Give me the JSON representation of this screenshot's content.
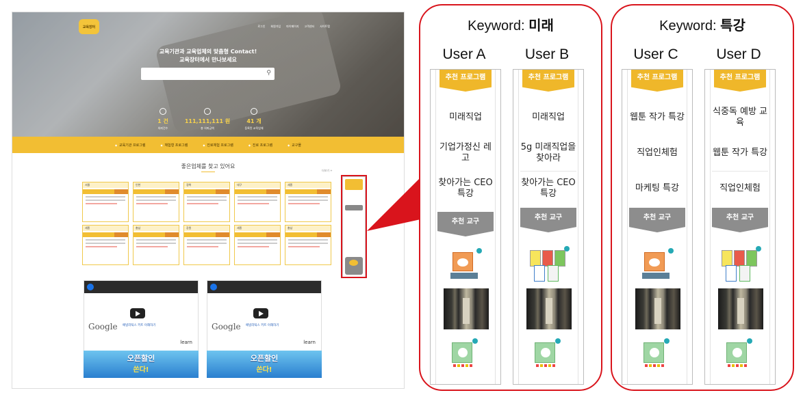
{
  "site": {
    "logo_text": "교육장터",
    "topnav": [
      "로그인",
      "회원가입",
      "마이페이지",
      "고객센터",
      "사이트맵"
    ],
    "hero_line1": "교육기관과 교육업체의 맞춤형 Contact!",
    "hero_line2": "교육장터에서 만나보세요",
    "search_placeholder": "",
    "stats": [
      {
        "value": "1 건",
        "label": "의뢰건수"
      },
      {
        "value": "111,111,111 원",
        "label": "총 의뢰금액"
      },
      {
        "value": "41 개",
        "label": "등록된 교육업체"
      }
    ],
    "categories": [
      "교육기관 프로그램",
      "체험형 프로그램",
      "진로체험 프로그램",
      "진로 프로그램",
      "교구몰"
    ],
    "section_title": "좋은업체를 찾고 있어요",
    "section_more": "더보기 +",
    "cards_row1": [
      "서울",
      "인천",
      "경북",
      "대구",
      "세종"
    ],
    "cards_row2": [
      "세종",
      "충남",
      "강원",
      "세종",
      "충남"
    ],
    "video_title": "애널리틱스 키트 이해하기",
    "video_brand": "Google",
    "video_learn": "learn",
    "banner_main": "오픈할인",
    "banner_sub": "쏜다!"
  },
  "panels": [
    {
      "keyword_prefix": "Keyword: ",
      "keyword": "미래",
      "users": [
        {
          "name": "User A",
          "programs": [
            "미래직업",
            "기업가정신 레고",
            "찾아가는 CEO 특강"
          ]
        },
        {
          "name": "User B",
          "programs": [
            "미래직업",
            "5g 미래직업을 찾아라",
            "찾아가는 CEO 특강"
          ]
        }
      ]
    },
    {
      "keyword_prefix": "Keyword: ",
      "keyword": "특강",
      "users": [
        {
          "name": "User C",
          "programs": [
            "웹툰 작가 특강",
            "직업인체험",
            "마케팅 특강"
          ]
        },
        {
          "name": "User D",
          "programs": [
            "식중독 예방 교육",
            "웹툰 작가 특강",
            "직업인체험"
          ]
        }
      ]
    }
  ],
  "labels": {
    "recommended_program": "추천 프로그램",
    "recommended_tool": "추천 교구"
  },
  "colors": {
    "accent_yellow": "#efb72a",
    "highlight_red": "#d9141c",
    "tool_gray": "#8d8d8d"
  }
}
